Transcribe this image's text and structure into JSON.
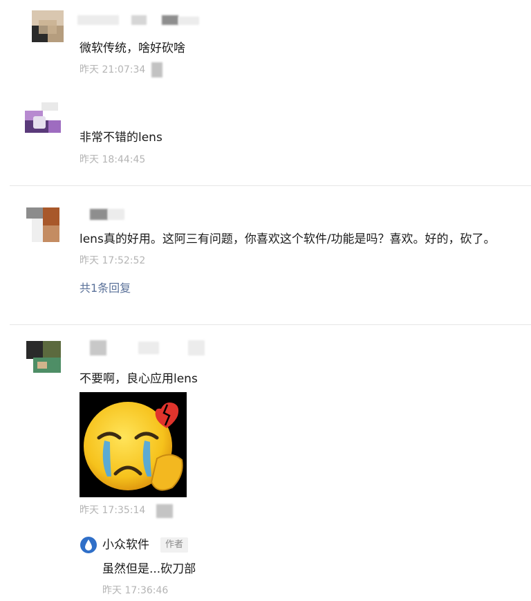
{
  "comments": [
    {
      "text": "微软传统，啥好砍啥",
      "time": "昨天 21:07:34"
    },
    {
      "text": "非常不错的lens",
      "time": "昨天 18:44:45"
    },
    {
      "text": "lens真的好用。这阿三有问题，你喜欢这个软件/功能是吗？喜欢。好的，砍了。",
      "time": "昨天 17:52:52",
      "reply_link": "共1条回复"
    },
    {
      "text": "不要啊，良心应用lens",
      "time": "昨天 17:35:14",
      "sticker": "crying-emoji-broken-heart"
    }
  ],
  "author_reply": {
    "name": "小众软件",
    "badge": "作者",
    "text": "虽然但是...砍刀部",
    "time": "昨天 17:36:46"
  },
  "colors": {
    "link": "#5a7199",
    "time": "#b4b4b4",
    "text": "#1a1a1a",
    "divider": "#e6e6e6",
    "author_logo": "#2f6fc8"
  }
}
